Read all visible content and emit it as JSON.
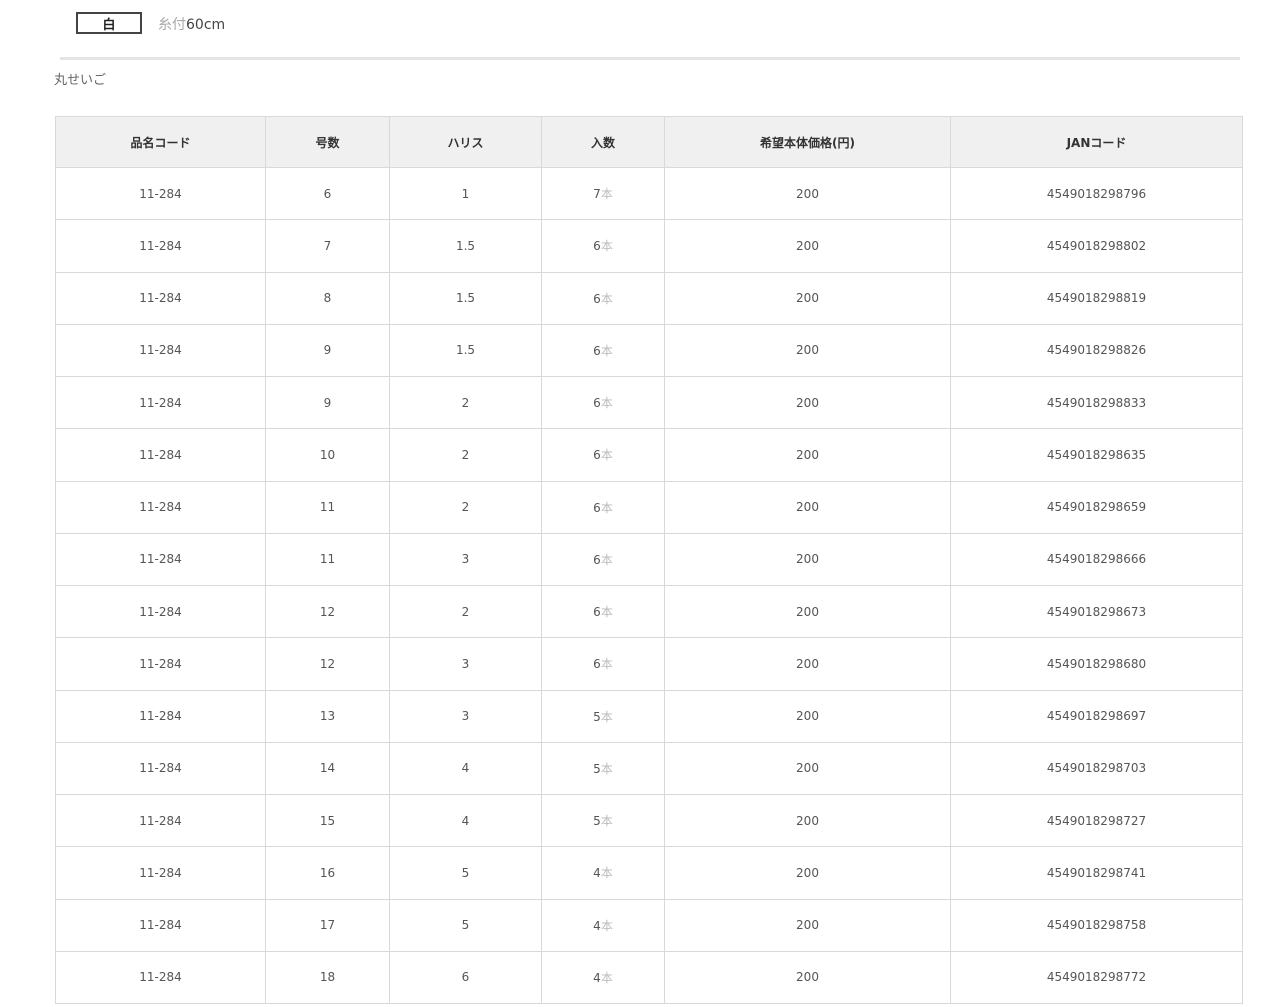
{
  "header": {
    "color_label": "白",
    "length_prefix": "糸付",
    "length_value": "60cm"
  },
  "section_label": "丸せいご",
  "table": {
    "columns": [
      "品名コード",
      "号数",
      "ハリス",
      "入数",
      "希望本体価格(円)",
      "JANコード"
    ],
    "rows": [
      {
        "code": "11-284",
        "size": "6",
        "harris": "1",
        "count": "7",
        "unit": "本",
        "price": "200",
        "jan": "4549018298796"
      },
      {
        "code": "11-284",
        "size": "7",
        "harris": "1.5",
        "count": "6",
        "unit": "本",
        "price": "200",
        "jan": "4549018298802"
      },
      {
        "code": "11-284",
        "size": "8",
        "harris": "1.5",
        "count": "6",
        "unit": "本",
        "price": "200",
        "jan": "4549018298819"
      },
      {
        "code": "11-284",
        "size": "9",
        "harris": "1.5",
        "count": "6",
        "unit": "本",
        "price": "200",
        "jan": "4549018298826"
      },
      {
        "code": "11-284",
        "size": "9",
        "harris": "2",
        "count": "6",
        "unit": "本",
        "price": "200",
        "jan": "4549018298833"
      },
      {
        "code": "11-284",
        "size": "10",
        "harris": "2",
        "count": "6",
        "unit": "本",
        "price": "200",
        "jan": "4549018298635"
      },
      {
        "code": "11-284",
        "size": "11",
        "harris": "2",
        "count": "6",
        "unit": "本",
        "price": "200",
        "jan": "4549018298659"
      },
      {
        "code": "11-284",
        "size": "11",
        "harris": "3",
        "count": "6",
        "unit": "本",
        "price": "200",
        "jan": "4549018298666"
      },
      {
        "code": "11-284",
        "size": "12",
        "harris": "2",
        "count": "6",
        "unit": "本",
        "price": "200",
        "jan": "4549018298673"
      },
      {
        "code": "11-284",
        "size": "12",
        "harris": "3",
        "count": "6",
        "unit": "本",
        "price": "200",
        "jan": "4549018298680"
      },
      {
        "code": "11-284",
        "size": "13",
        "harris": "3",
        "count": "5",
        "unit": "本",
        "price": "200",
        "jan": "4549018298697"
      },
      {
        "code": "11-284",
        "size": "14",
        "harris": "4",
        "count": "5",
        "unit": "本",
        "price": "200",
        "jan": "4549018298703"
      },
      {
        "code": "11-284",
        "size": "15",
        "harris": "4",
        "count": "5",
        "unit": "本",
        "price": "200",
        "jan": "4549018298727"
      },
      {
        "code": "11-284",
        "size": "16",
        "harris": "5",
        "count": "4",
        "unit": "本",
        "price": "200",
        "jan": "4549018298741"
      },
      {
        "code": "11-284",
        "size": "17",
        "harris": "5",
        "count": "4",
        "unit": "本",
        "price": "200",
        "jan": "4549018298758"
      },
      {
        "code": "11-284",
        "size": "18",
        "harris": "6",
        "count": "4",
        "unit": "本",
        "price": "200",
        "jan": "4549018298772"
      }
    ]
  }
}
